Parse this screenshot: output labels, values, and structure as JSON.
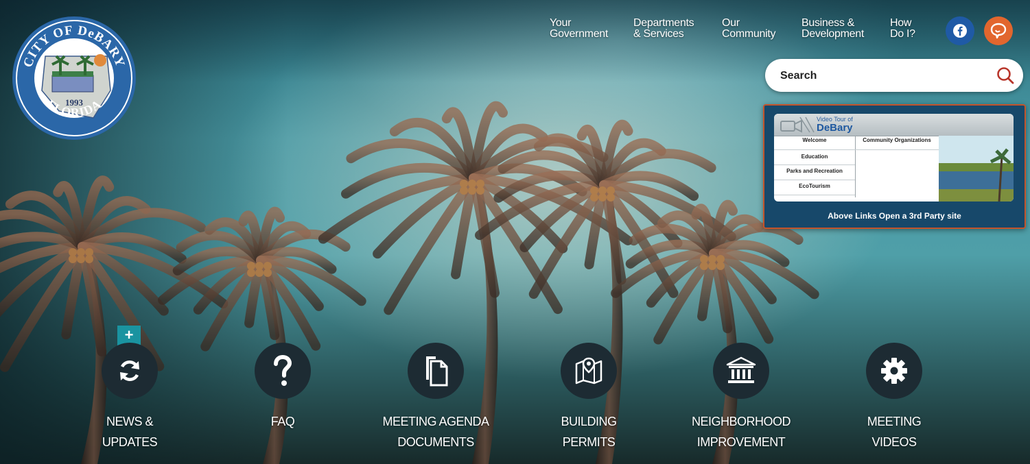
{
  "header": {
    "logo_top_text": "CITY OF DeBARY",
    "logo_bottom_text": "FLORIDA",
    "logo_year": "1993",
    "nav": [
      {
        "label": "Your\nGovernment"
      },
      {
        "label": "Departments\n& Services"
      },
      {
        "label": "Our\nCommunity"
      },
      {
        "label": "Business &\nDevelopment"
      },
      {
        "label": "How\nDo I?"
      }
    ],
    "social": [
      {
        "icon": "facebook-icon",
        "glyph": "f",
        "color": "#1f5aa6"
      },
      {
        "icon": "chat-icon",
        "color": "#e2662e"
      }
    ]
  },
  "search": {
    "placeholder": "Search",
    "icon": "search-icon",
    "icon_color": "#b8352a"
  },
  "video_tour": {
    "header_small": "Video Tour of",
    "header_title": "DeBary",
    "links_left": [
      "Welcome",
      "Education",
      "Parks and Recreation",
      "EcoTourism"
    ],
    "links_right": [
      "Community Organizations"
    ],
    "note": "Above Links Open a 3rd Party site"
  },
  "quick_links": {
    "expand_label": "+",
    "items": [
      {
        "icon": "refresh-icon",
        "label": "NEWS &\nUPDATES"
      },
      {
        "icon": "question-icon",
        "label": "FAQ"
      },
      {
        "icon": "documents-icon",
        "label": "MEETING AGENDA\nDOCUMENTS"
      },
      {
        "icon": "map-pin-icon",
        "label": "BUILDING\nPERMITS"
      },
      {
        "icon": "building-icon",
        "label": "NEIGHBORHOOD\nIMPROVEMENT"
      },
      {
        "icon": "gear-icon",
        "label": "MEETING\nVIDEOS"
      }
    ]
  },
  "colors": {
    "accent_teal": "#1a93a0",
    "logo_blue": "#2b67a8",
    "tour_blue": "#17486a",
    "tour_border": "#c4532a"
  }
}
